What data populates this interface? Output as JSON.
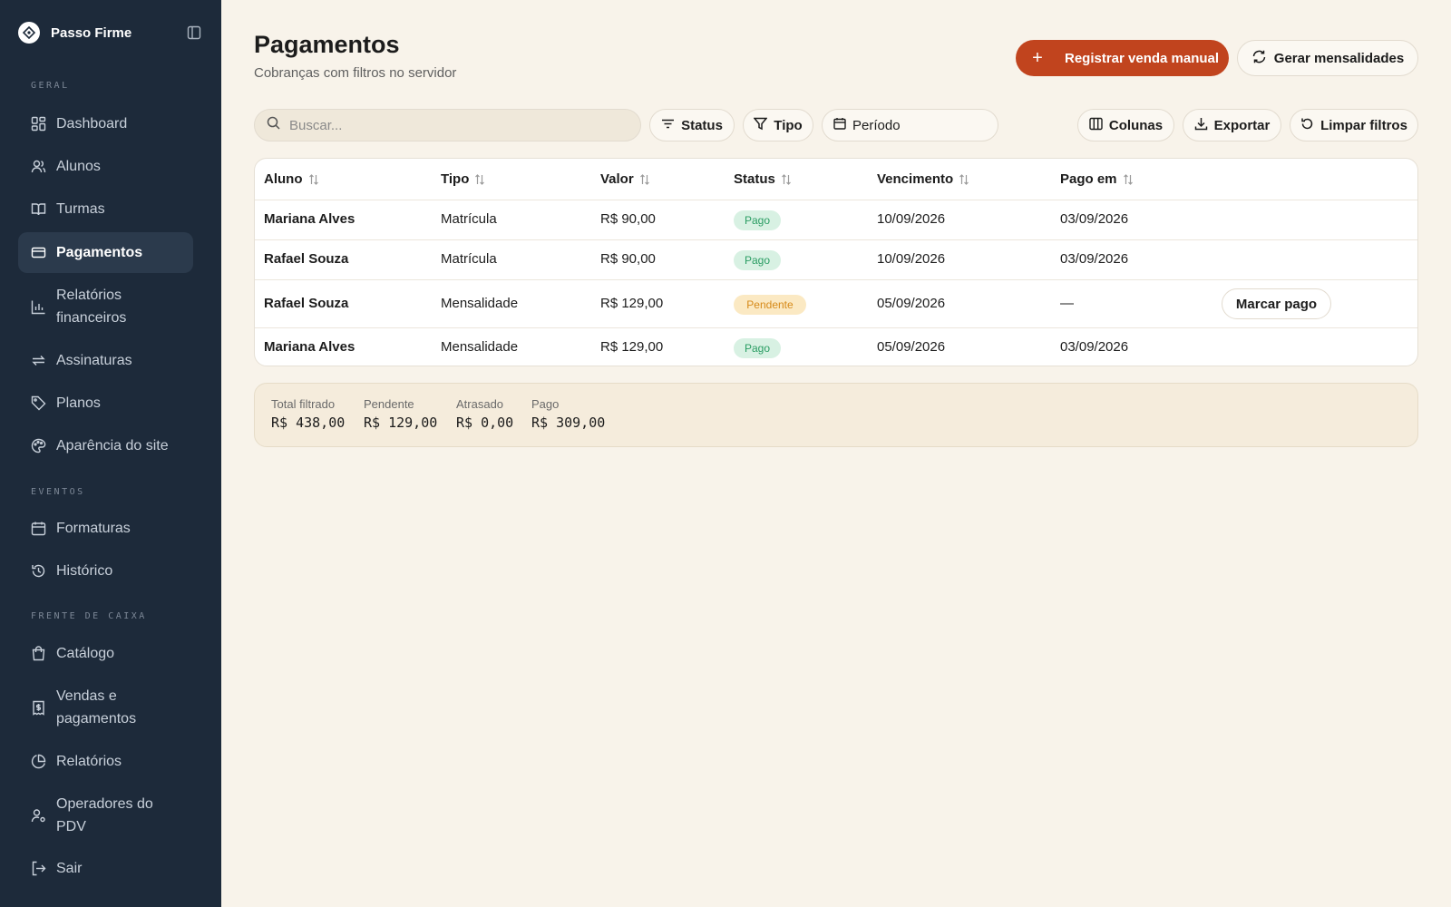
{
  "app": {
    "name": "Passo Firme"
  },
  "sidebar": {
    "sections": {
      "geral": "GERAL",
      "eventos": "EVENTOS",
      "caixa": "FRENTE DE CAIXA"
    },
    "items": [
      {
        "label": "Dashboard",
        "icon": "dashboard-icon"
      },
      {
        "label": "Alunos",
        "icon": "users-icon"
      },
      {
        "label": "Turmas",
        "icon": "book-icon"
      },
      {
        "label": "Pagamentos",
        "icon": "credit-card-icon",
        "active": true
      },
      {
        "label": "Relatórios financeiros",
        "icon": "bar-chart-icon"
      },
      {
        "label": "Assinaturas",
        "icon": "repeat-icon"
      },
      {
        "label": "Planos",
        "icon": "tag-icon"
      },
      {
        "label": "Aparência do site",
        "icon": "palette-icon"
      },
      {
        "label": "Formaturas",
        "icon": "calendar-icon"
      },
      {
        "label": "Histórico",
        "icon": "history-icon"
      },
      {
        "label": "Catálogo",
        "icon": "shopping-bag-icon"
      },
      {
        "label": "Vendas e pagamentos",
        "icon": "receipt-icon"
      },
      {
        "label": "Relatórios",
        "icon": "pie-chart-icon"
      },
      {
        "label": "Operadores do PDV",
        "icon": "user-cog-icon"
      },
      {
        "label": "Sair",
        "icon": "logout-icon"
      }
    ]
  },
  "header": {
    "title": "Pagamentos",
    "subtitle": "Cobranças com filtros no servidor",
    "primary_action": "Registrar venda manual",
    "secondary_action": "Gerar mensalidades"
  },
  "toolbar": {
    "search_placeholder": "Buscar...",
    "status": "Status",
    "tipo": "Tipo",
    "periodo": "Período",
    "colunas": "Colunas",
    "exportar": "Exportar",
    "limpar": "Limpar filtros"
  },
  "table": {
    "columns": [
      "Aluno",
      "Tipo",
      "Valor",
      "Status",
      "Vencimento",
      "Pago em"
    ],
    "rows": [
      {
        "aluno": "Mariana Alves",
        "tipo": "Matrícula",
        "valor": "R$ 90,00",
        "status": "Pago",
        "vencimento": "10/09/2026",
        "pago_em": "03/09/2026",
        "action": ""
      },
      {
        "aluno": "Rafael Souza",
        "tipo": "Matrícula",
        "valor": "R$ 90,00",
        "status": "Pago",
        "vencimento": "10/09/2026",
        "pago_em": "03/09/2026",
        "action": ""
      },
      {
        "aluno": "Rafael Souza",
        "tipo": "Mensalidade",
        "valor": "R$ 129,00",
        "status": "Pendente",
        "vencimento": "05/09/2026",
        "pago_em": "—",
        "action": "Marcar pago"
      },
      {
        "aluno": "Mariana Alves",
        "tipo": "Mensalidade",
        "valor": "R$ 129,00",
        "status": "Pago",
        "vencimento": "05/09/2026",
        "pago_em": "03/09/2026",
        "action": ""
      }
    ]
  },
  "summary": [
    {
      "label": "Total filtrado",
      "value": "R$ 438,00"
    },
    {
      "label": "Pendente",
      "value": "R$ 129,00"
    },
    {
      "label": "Atrasado",
      "value": "R$ 0,00"
    },
    {
      "label": "Pago",
      "value": "R$ 309,00"
    }
  ],
  "colors": {
    "sidebar_bg": "#1d2a3a",
    "page_bg": "#f8f3ea",
    "accent": "#c1441e",
    "status_paid": "#2a9d63",
    "status_pending": "#d68a19"
  }
}
